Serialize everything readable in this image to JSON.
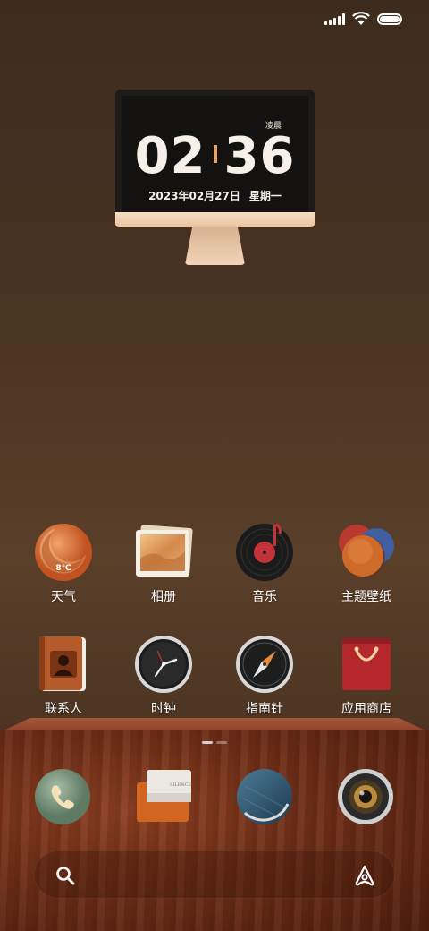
{
  "clock": {
    "ampm": "凌晨",
    "hours": "02",
    "minutes": "36",
    "date": "2023年02月27日",
    "weekday": "星期一"
  },
  "apps": [
    {
      "label": "天气",
      "icon": "weather-icon",
      "temp": "8℃"
    },
    {
      "label": "相册",
      "icon": "gallery-icon"
    },
    {
      "label": "音乐",
      "icon": "music-icon"
    },
    {
      "label": "主题壁纸",
      "icon": "themes-icon"
    },
    {
      "label": "联系人",
      "icon": "contacts-icon"
    },
    {
      "label": "时钟",
      "icon": "clock-icon"
    },
    {
      "label": "指南针",
      "icon": "compass-icon"
    },
    {
      "label": "应用商店",
      "icon": "app-store-icon"
    }
  ],
  "dock": [
    {
      "icon": "phone-icon"
    },
    {
      "icon": "messages-icon",
      "text": "SILENCE"
    },
    {
      "icon": "browser-icon"
    },
    {
      "icon": "camera-icon"
    }
  ],
  "search": {
    "icon": "search-icon",
    "assistant_icon": "assistant-icon"
  },
  "colors": {
    "accent": "#e7a36a",
    "shelf": "#7a3519",
    "background": "#4a3422"
  }
}
